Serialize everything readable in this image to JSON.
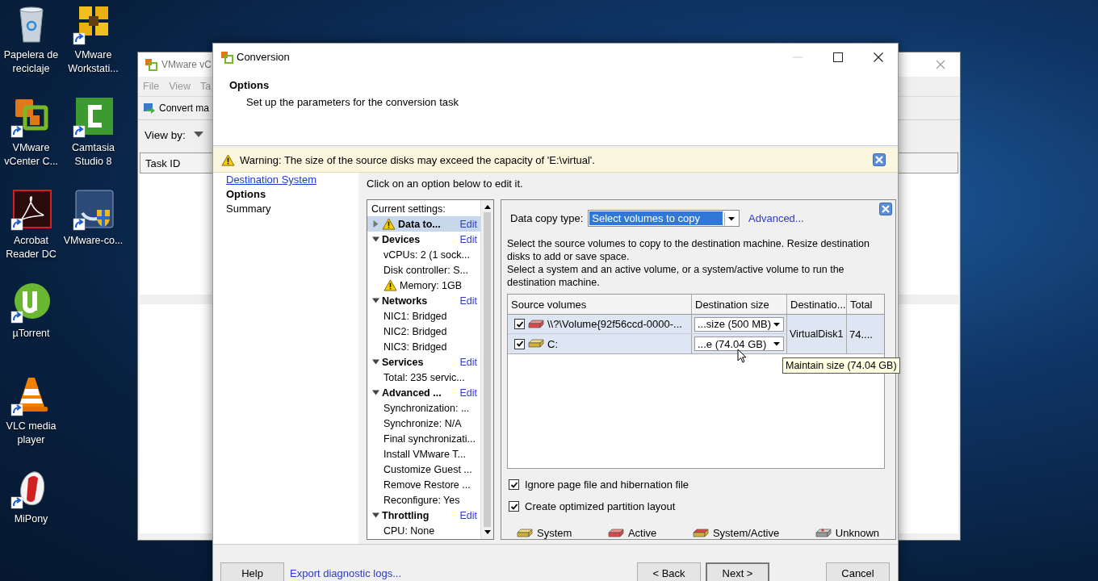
{
  "desktop": {
    "icons": [
      {
        "label": "Papelera de reciclaje",
        "kind": "recycle",
        "shortcut": false
      },
      {
        "label": "VMware vCenter C...",
        "kind": "vcenter",
        "shortcut": true
      },
      {
        "label": "Acrobat Reader DC",
        "kind": "acrobat",
        "shortcut": true
      },
      {
        "label": "µTorrent",
        "kind": "utorrent",
        "shortcut": true
      },
      {
        "label": "VLC media player",
        "kind": "vlc",
        "shortcut": true
      },
      {
        "label": "MiPony",
        "kind": "mipony",
        "shortcut": true
      },
      {
        "label": "VMware Workstati...",
        "kind": "workstation",
        "shortcut": true
      },
      {
        "label": "Camtasia Studio 8",
        "kind": "camtasia",
        "shortcut": true
      },
      {
        "label": "VMware-co...",
        "kind": "converter",
        "shortcut": true
      }
    ]
  },
  "back_window": {
    "title": "VMware vC",
    "menu": [
      "File",
      "View",
      "Ta"
    ],
    "toolbar": "Convert ma",
    "view_by": "View by:",
    "column": "Task ID"
  },
  "dialog": {
    "title": "Conversion",
    "header": {
      "title": "Options",
      "subtitle": "Set up the parameters for the conversion task"
    },
    "warning": "Warning: The size of the source disks may exceed the capacity of 'E:\\virtual'.",
    "nav": [
      {
        "label": "Destination System",
        "kind": "link",
        "selected": false
      },
      {
        "label": "Options",
        "kind": "plain",
        "selected": true
      },
      {
        "label": "Summary",
        "kind": "plain",
        "selected": false
      }
    ],
    "instruction": "Click on an option below to edit it.",
    "settings": {
      "header": "Current settings:",
      "groups": [
        {
          "title": "Data to...",
          "edit": "Edit",
          "expanded": false,
          "selected": true,
          "warning": true
        },
        {
          "title": "Devices",
          "edit": "Edit",
          "expanded": true,
          "selected": false,
          "warning": false,
          "children": [
            {
              "text": "vCPUs: 2 (1 sock...",
              "warning": false
            },
            {
              "text": "Disk controller: S...",
              "warning": false
            },
            {
              "text": "Memory: 1GB",
              "warning": true
            }
          ]
        },
        {
          "title": "Networks",
          "edit": "Edit",
          "expanded": true,
          "selected": false,
          "warning": false,
          "children": [
            {
              "text": "NIC1: Bridged",
              "warning": false
            },
            {
              "text": "NIC2: Bridged",
              "warning": false
            },
            {
              "text": "NIC3: Bridged",
              "warning": false
            }
          ]
        },
        {
          "title": "Services",
          "edit": "Edit",
          "expanded": true,
          "selected": false,
          "warning": false,
          "children": [
            {
              "text": "Total: 235 servic...",
              "warning": false
            }
          ]
        },
        {
          "title": "Advanced ...",
          "edit": "Edit",
          "expanded": true,
          "selected": false,
          "warning": false,
          "children": [
            {
              "text": "Synchronization: ...",
              "warning": false
            },
            {
              "text": "Synchronize: N/A",
              "warning": false
            },
            {
              "text": "Final synchronizati...",
              "warning": false
            },
            {
              "text": "Install VMware T...",
              "warning": false
            },
            {
              "text": "Customize Guest ...",
              "warning": false
            },
            {
              "text": "Remove Restore ...",
              "warning": false
            },
            {
              "text": "Reconfigure: Yes",
              "warning": false
            }
          ]
        },
        {
          "title": "Throttling",
          "edit": "Edit",
          "expanded": true,
          "selected": false,
          "warning": false,
          "children": [
            {
              "text": "CPU: None",
              "warning": false
            }
          ]
        }
      ]
    },
    "detail": {
      "copy_type_label": "Data copy type:",
      "copy_type_value": "Select volumes to copy",
      "advanced_link": "Advanced...",
      "paragraphs": [
        "Select the source volumes to copy to the destination machine. Resize destination disks to add or save space.",
        "Select a system and an active volume, or a system/active volume to run the destination machine."
      ],
      "table": {
        "columns": [
          "Source volumes",
          "Destination size",
          "Destinatio...",
          "Total"
        ],
        "rows": [
          {
            "checked": true,
            "kind": "active",
            "source": "\\\\?\\Volume{92f56ccd-0000-...",
            "dest_size": "...size (500 MB)"
          },
          {
            "checked": true,
            "kind": "system",
            "source": "C:",
            "dest_size": "...e (74.04 GB)"
          }
        ],
        "destination": "VirtualDisk1",
        "total": "74...."
      },
      "options": [
        {
          "label": "Ignore page file and hibernation file",
          "checked": true
        },
        {
          "label": "Create optimized partition layout",
          "checked": true
        }
      ],
      "legend": [
        {
          "label": "System",
          "kind": "system"
        },
        {
          "label": "Active",
          "kind": "active"
        },
        {
          "label": "System/Active",
          "kind": "system_active"
        },
        {
          "label": "Unknown",
          "kind": "unknown"
        }
      ]
    },
    "tooltip": "Maintain size (74.04 GB)",
    "footer": {
      "help": "Help",
      "export_link": "Export diagnostic logs...",
      "back": "< Back",
      "next": "Next >",
      "cancel": "Cancel"
    }
  }
}
